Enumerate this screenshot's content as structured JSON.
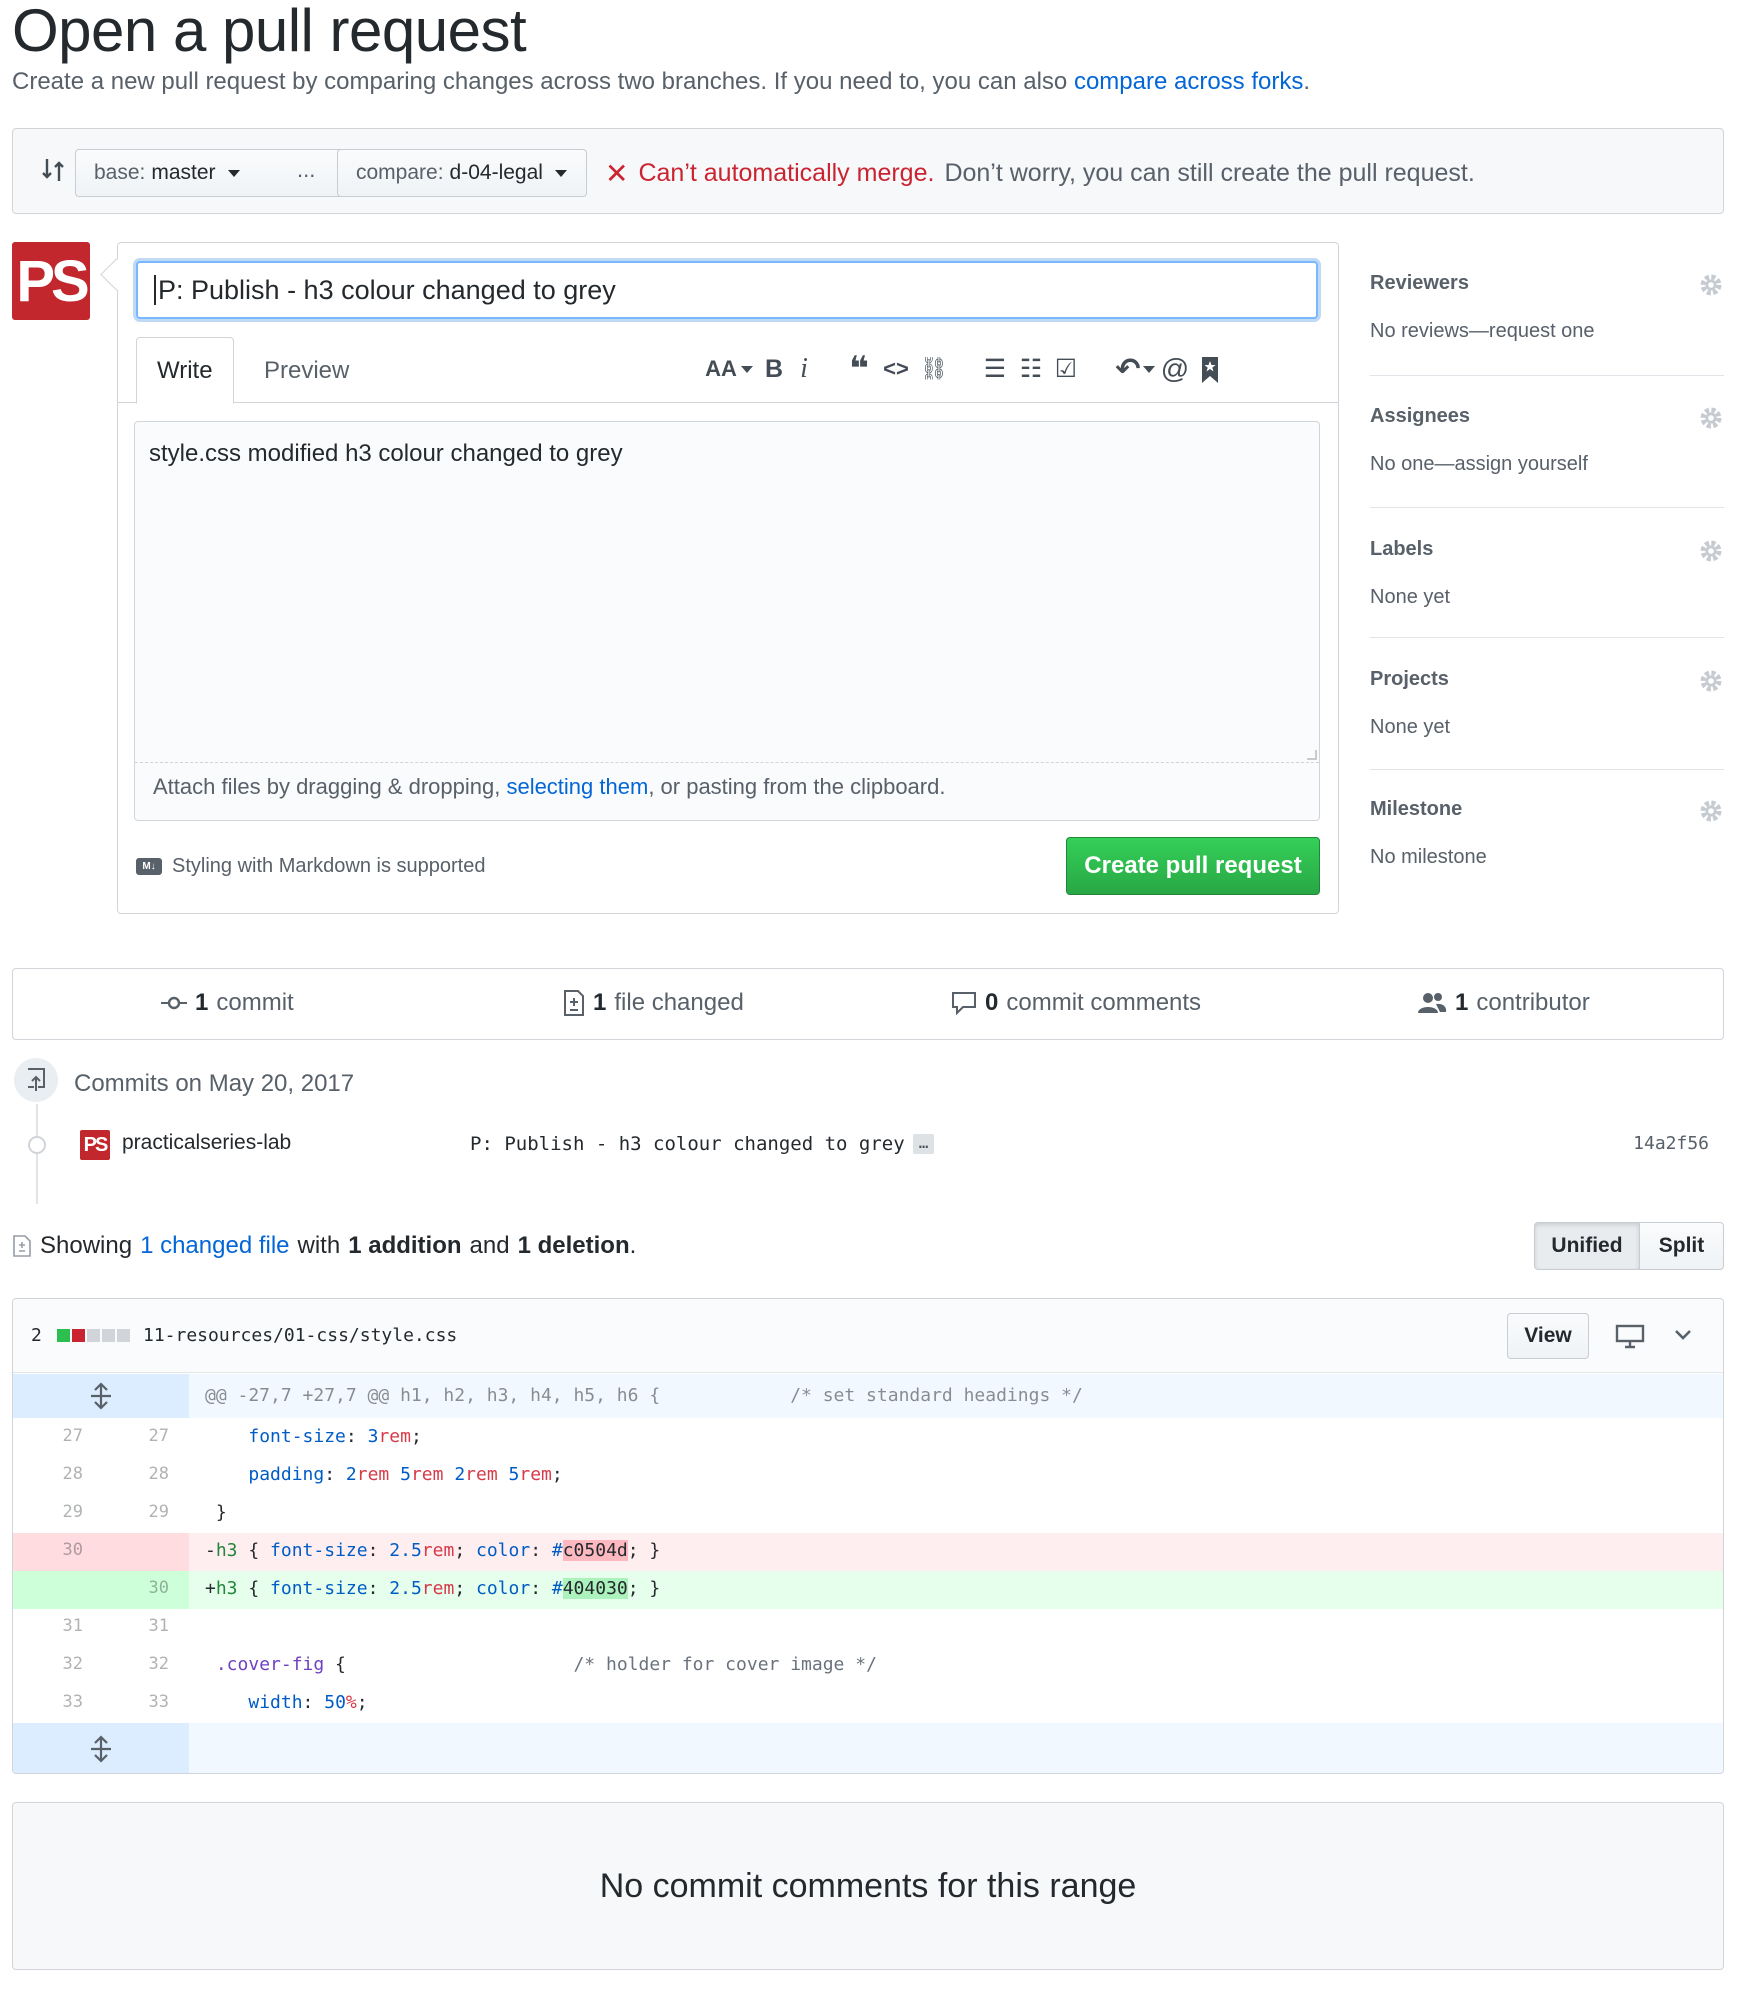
{
  "header": {
    "title": "Open a pull request",
    "subtitle": "Create a new pull request by comparing changes across two branches. If you need to, you can also ",
    "subtitle_link": "compare across forks",
    "subtitle_end": "."
  },
  "range": {
    "base_label": "base:",
    "base_value": "master",
    "ellipsis": "...",
    "compare_label": "compare:",
    "compare_value": "d-04-legal",
    "merge_error": "Can’t automatically merge.",
    "merge_note": "Don’t worry, you can still create the pull request."
  },
  "avatar": {
    "initials": "PS",
    "color": "#c1272d"
  },
  "compose": {
    "title_value": "P: Publish - h3 colour changed to grey",
    "tab_write": "Write",
    "tab_preview": "Preview",
    "body_value": "style.css modified h3 colour changed to grey",
    "attach_prefix": "Attach files by dragging & dropping, ",
    "attach_link": "selecting them",
    "attach_suffix": ", or pasting from the clipboard.",
    "markdown_note": "Styling with Markdown is supported",
    "markdown_badge": "M↓",
    "create_button": "Create pull request",
    "create_color": "#28a745"
  },
  "toolbar": {
    "heading": "AA",
    "bold": "B",
    "italic": "i",
    "quote": "❝",
    "code": "<>",
    "link": "⛓",
    "ul": "☰",
    "ol": "☷",
    "task": "☑",
    "reply": "↶",
    "mention": "@",
    "bookmark": "🔖"
  },
  "sidebar": [
    {
      "heading": "Reviewers",
      "value": "No reviews—request one"
    },
    {
      "heading": "Assignees",
      "value": "No one—assign yourself"
    },
    {
      "heading": "Labels",
      "value": "None yet"
    },
    {
      "heading": "Projects",
      "value": "None yet"
    },
    {
      "heading": "Milestone",
      "value": "No milestone"
    }
  ],
  "summary": {
    "commits_n": "1",
    "commits_l": "commit",
    "files_n": "1",
    "files_l": "file changed",
    "comments_n": "0",
    "comments_l": "commit comments",
    "contrib_n": "1",
    "contrib_l": "contributor"
  },
  "commits": {
    "group_date": "Commits on May 20, 2017",
    "author": "practicalseries-lab",
    "message": "P: Publish - h3 colour changed to grey",
    "more": "…",
    "sha": "14a2f56"
  },
  "changes": {
    "showing": "Showing",
    "changed_link": "1 changed file",
    "with": "with",
    "additions": "1 addition",
    "and": "and",
    "deletions": "1 deletion",
    "period": ".",
    "unified": "Unified",
    "split": "Split"
  },
  "file": {
    "count": "2",
    "path": "11-resources/01-css/style.css",
    "view_button": "View",
    "colors": {
      "add": "#2cbe4e",
      "del": "#cb2431",
      "neutral": "#d1d5da"
    }
  },
  "diff": {
    "hunk_header": "@@ -27,7 +27,7 @@ h1, h2, h3, h4, h5, h6 {            /* set standard headings */",
    "lines": [
      {
        "old": "27",
        "new": "27"
      },
      {
        "old": "28",
        "new": "28"
      },
      {
        "old": "29",
        "new": "29"
      },
      {
        "old": "30",
        "new": ""
      },
      {
        "old": "",
        "new": "30"
      },
      {
        "old": "31",
        "new": "31"
      },
      {
        "old": "32",
        "new": "32"
      },
      {
        "old": "33",
        "new": "33"
      }
    ]
  },
  "footer": {
    "no_comments": "No commit comments for this range"
  }
}
